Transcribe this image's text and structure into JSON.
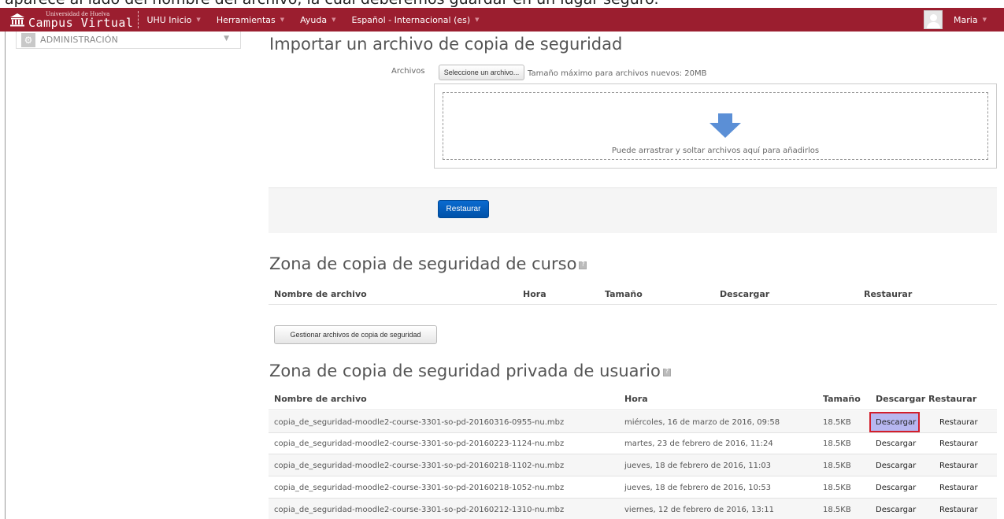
{
  "caption": "aparece al lado del nombre del archivo, la cual deberemos guardar en un lugar seguro.",
  "navbar": {
    "brand_sub": "Universidad de Huelva",
    "brand_main": "Campus Virtual",
    "items": [
      {
        "label": "UHU Inicio"
      },
      {
        "label": "Herramientas"
      },
      {
        "label": "Ayuda"
      },
      {
        "label": "Español - Internacional (es)"
      }
    ],
    "user": "Maria"
  },
  "sidebar": {
    "admin_label": "ADMINISTRACIÓN"
  },
  "import": {
    "title": "Importar un archivo de copia de seguridad",
    "files_label": "Archivos",
    "select_button": "Seleccione un archivo...",
    "max_size": "Tamaño máximo para archivos nuevos: 20MB",
    "drop_text": "Puede arrastrar y soltar archivos aquí para añadirlos",
    "restore_button": "Restaurar"
  },
  "course_zone": {
    "title": "Zona de copia de seguridad de curso",
    "headers": [
      "Nombre de archivo",
      "Hora",
      "Tamaño",
      "Descargar",
      "Restaurar"
    ],
    "manage_button": "Gestionar archivos de copia de seguridad"
  },
  "user_zone": {
    "title": "Zona de copia de seguridad privada de usuario",
    "headers": [
      "Nombre de archivo",
      "Hora",
      "Tamaño",
      "Descargar",
      "Restaurar"
    ],
    "rows": [
      {
        "name": "copia_de_seguridad-moodle2-course-3301-so-pd-20160316-0955-nu.mbz",
        "time": "miércoles, 16 de marzo de 2016, 09:58",
        "size": "18.5KB",
        "download": "Descargar",
        "restore": "Restaurar"
      },
      {
        "name": "copia_de_seguridad-moodle2-course-3301-so-pd-20160223-1124-nu.mbz",
        "time": "martes, 23 de febrero de 2016, 11:24",
        "size": "18.5KB",
        "download": "Descargar",
        "restore": "Restaurar"
      },
      {
        "name": "copia_de_seguridad-moodle2-course-3301-so-pd-20160218-1102-nu.mbz",
        "time": "jueves, 18 de febrero de 2016, 11:03",
        "size": "18.5KB",
        "download": "Descargar",
        "restore": "Restaurar"
      },
      {
        "name": "copia_de_seguridad-moodle2-course-3301-so-pd-20160218-1052-nu.mbz",
        "time": "jueves, 18 de febrero de 2016, 10:53",
        "size": "18.5KB",
        "download": "Descargar",
        "restore": "Restaurar"
      },
      {
        "name": "copia_de_seguridad-moodle2-course-3301-so-pd-20160212-1310-nu.mbz",
        "time": "viernes, 12 de febrero de 2016, 13:11",
        "size": "18.5KB",
        "download": "Descargar",
        "restore": "Restaurar"
      }
    ]
  },
  "colors": {
    "navbar": "#9b1e2f",
    "primary_button": "#0a6bd0",
    "highlight_fill": "#b7b7f0",
    "highlight_border": "#d21e2c"
  }
}
